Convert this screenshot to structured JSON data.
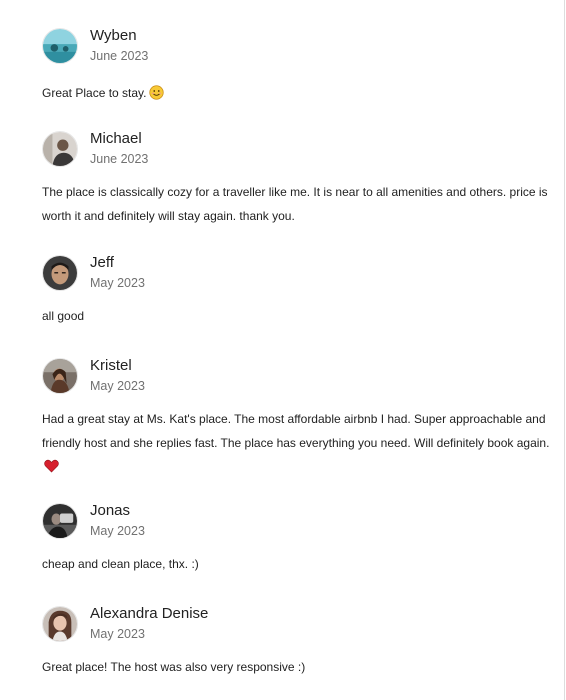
{
  "reviews": [
    {
      "name": "Wyben",
      "date": "June 2023",
      "text": "Great Place to stay.",
      "emoji": "smiling-face-icon"
    },
    {
      "name": "Michael",
      "date": "June 2023",
      "text": "The place is classically cozy for a traveller like me. It is near to all amenities and others. price is worth it and definitely will stay again. thank you."
    },
    {
      "name": "Jeff",
      "date": "May 2023",
      "text": "all good"
    },
    {
      "name": "Kristel",
      "date": "May 2023",
      "text": "Had a great stay at Ms. Kat's place. The most affordable airbnb I had. Super approachable and friendly host and she replies fast. The place has everything you need. Will definitely book again.",
      "emoji": "red-heart-icon"
    },
    {
      "name": "Jonas",
      "date": "May 2023",
      "text": "cheap and clean place, thx. :)"
    },
    {
      "name": "Alexandra Denise",
      "date": "May 2023",
      "text": "Great place! The host was also very responsive :)"
    }
  ]
}
